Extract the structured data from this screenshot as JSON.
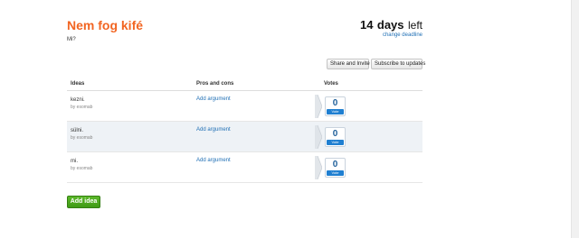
{
  "header": {
    "title": "Nem fog kifé",
    "description": "Mi?",
    "deadline_count": "14",
    "deadline_unit": "days",
    "deadline_suffix": "left",
    "change_deadline": "change deadline"
  },
  "toolbar": {
    "share_label": "Share and Invite",
    "subscribe_label": "Subscribe to updates"
  },
  "table": {
    "columns": [
      "Ideas",
      "Pros and cons",
      "Votes"
    ],
    "rows": [
      {
        "idea": "kezni.",
        "author": "by esomab",
        "argument_link": "Add argument",
        "votes": "0",
        "vote_label": "Vote"
      },
      {
        "idea": "sülni.",
        "author": "by esomab",
        "argument_link": "Add argument",
        "votes": "0",
        "vote_label": "Vote"
      },
      {
        "idea": "mi.",
        "author": "by esomab",
        "argument_link": "Add argument",
        "votes": "0",
        "vote_label": "Vote"
      }
    ]
  },
  "footer": {
    "add_idea_label": "Add idea"
  },
  "colors": {
    "title": "#f26522",
    "link": "#1f6fb5",
    "vote_accent": "#1f7fd1",
    "add_idea": "#4aa81f",
    "row_alt": "#eef2f6"
  }
}
